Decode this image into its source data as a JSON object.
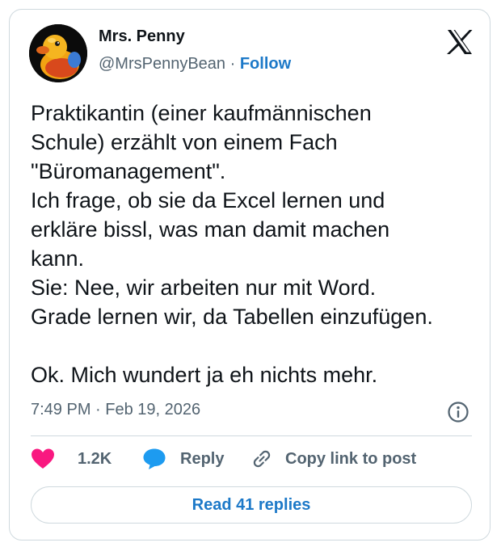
{
  "author": {
    "name": "Mrs. Penny",
    "handle": "@MrsPennyBean",
    "separator": " · ",
    "follow_label": "Follow",
    "avatar_icon": "rubber-duck-avatar"
  },
  "brand_icon": "x-logo-icon",
  "tweet": {
    "lines": [
      "Praktikantin (einer kaufmännischen",
      "Schule) erzählt von einem Fach",
      "\"Büromanagement\".",
      "Ich frage, ob sie da Excel lernen und",
      "erkläre bissl, was man damit machen",
      "kann.",
      "Sie: Nee, wir arbeiten nur mit Word.",
      "Grade lernen wir, da Tabellen einzufügen.",
      "",
      "Ok. Mich wundert ja eh nichts mehr."
    ],
    "time": "7:49 PM",
    "date": "Feb 19, 2026",
    "meta_separator": " · "
  },
  "actions": {
    "like_count": "1.2K",
    "reply_label": "Reply",
    "copy_label": "Copy link to post"
  },
  "read_replies_label": "Read 41 replies",
  "colors": {
    "link_blue": "#1d79c8",
    "like_pink": "#f91880",
    "reply_blue": "#1d9bf0",
    "border": "#cfd9de",
    "muted": "#536471"
  }
}
